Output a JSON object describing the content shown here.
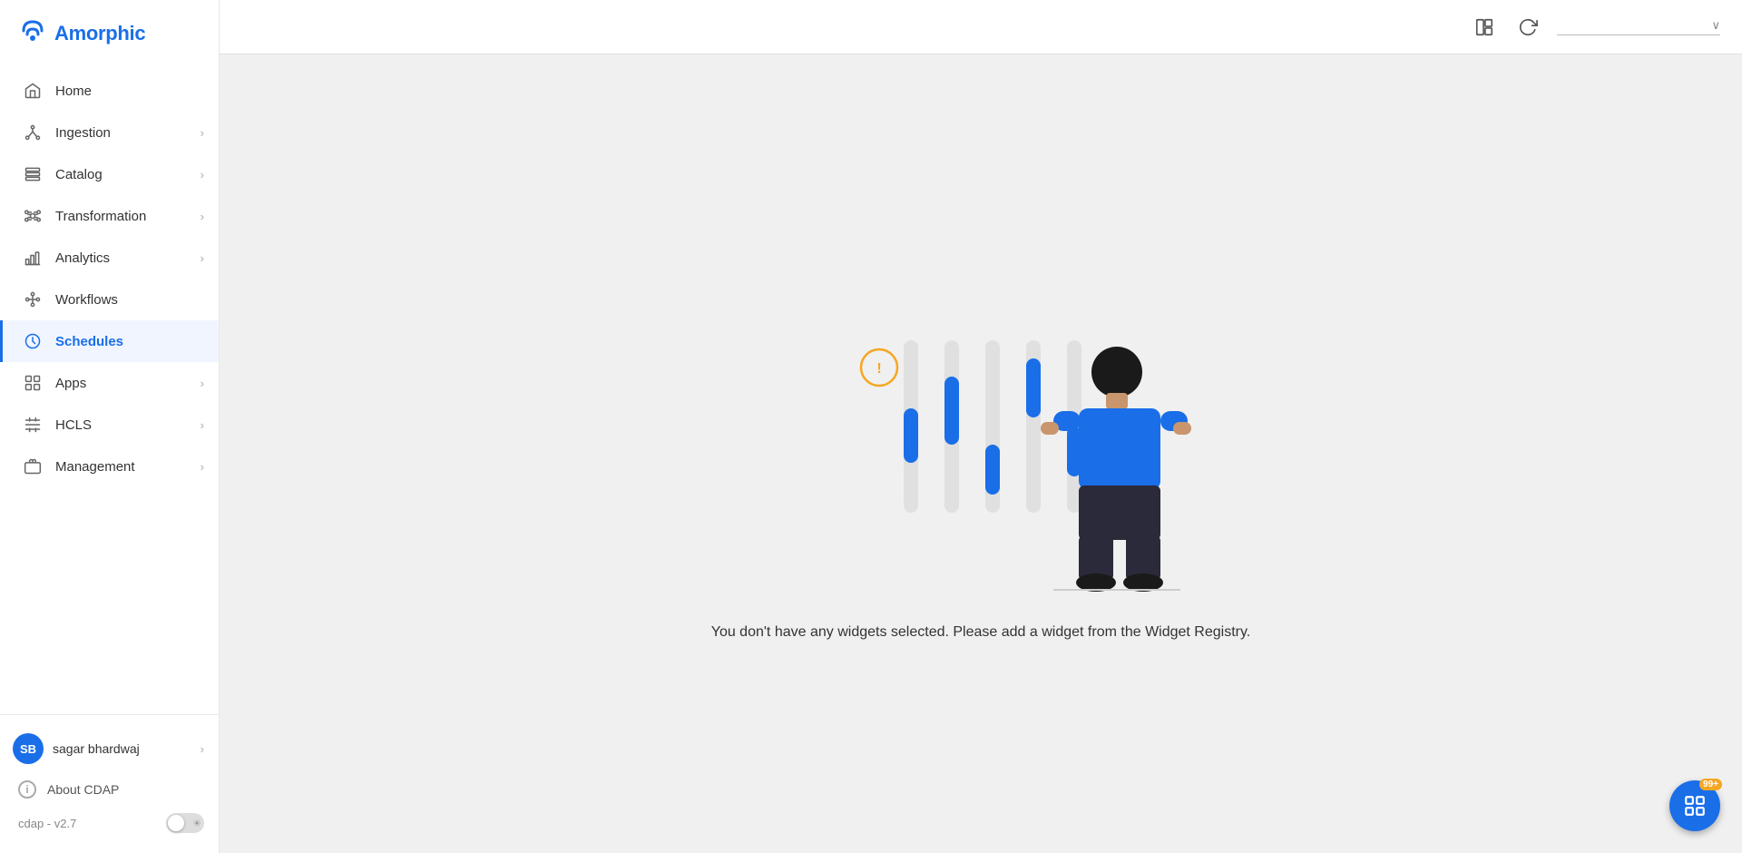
{
  "app": {
    "logo_text": "Amorphic",
    "version": "cdap - v2.7"
  },
  "sidebar": {
    "items": [
      {
        "id": "home",
        "label": "Home",
        "has_arrow": false,
        "active": false
      },
      {
        "id": "ingestion",
        "label": "Ingestion",
        "has_arrow": true,
        "active": false
      },
      {
        "id": "catalog",
        "label": "Catalog",
        "has_arrow": true,
        "active": false
      },
      {
        "id": "transformation",
        "label": "Transformation",
        "has_arrow": true,
        "active": false
      },
      {
        "id": "analytics",
        "label": "Analytics",
        "has_arrow": true,
        "active": false
      },
      {
        "id": "workflows",
        "label": "Workflows",
        "has_arrow": false,
        "active": false
      },
      {
        "id": "schedules",
        "label": "Schedules",
        "has_arrow": false,
        "active": true
      },
      {
        "id": "apps",
        "label": "Apps",
        "has_arrow": true,
        "active": false
      },
      {
        "id": "hcls",
        "label": "HCLS",
        "has_arrow": true,
        "active": false
      },
      {
        "id": "management",
        "label": "Management",
        "has_arrow": true,
        "active": false
      }
    ]
  },
  "user": {
    "name": "sagar bhardwaj",
    "initials": "SB"
  },
  "about": {
    "label": "About CDAP"
  },
  "topbar": {
    "dropdown_placeholder": ""
  },
  "main": {
    "empty_message": "You don't have any widgets selected. Please add a widget from the Widget Registry."
  },
  "fab": {
    "badge": "99+"
  }
}
